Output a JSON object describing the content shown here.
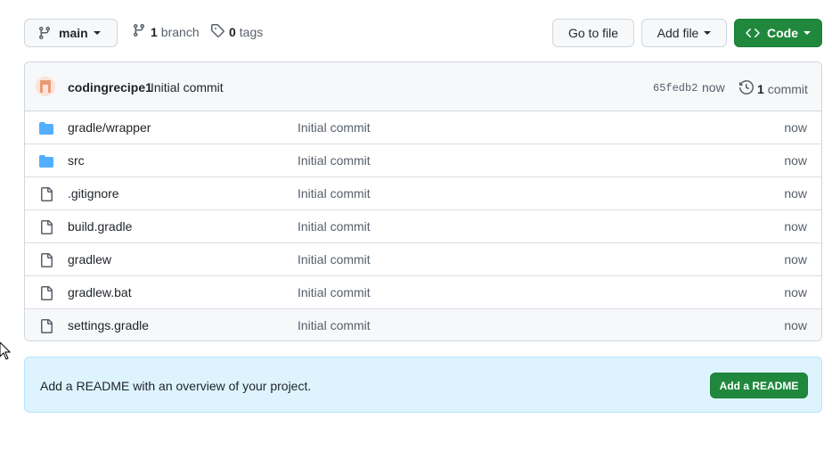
{
  "toolbar": {
    "branch_label": "main",
    "branches_count": "1",
    "branches_label": "branch",
    "tags_count": "0",
    "tags_label": "tags",
    "goto_label": "Go to file",
    "add_file_label": "Add file",
    "code_label": "Code"
  },
  "latest_commit": {
    "author": "codingrecipe1",
    "message": "Initial commit",
    "sha": "65fedb2",
    "time": "now",
    "commits_count": "1",
    "commits_label": "commit"
  },
  "files": [
    {
      "name": "gradle/wrapper",
      "type": "folder",
      "message": "Initial commit",
      "time": "now"
    },
    {
      "name": "src",
      "type": "folder",
      "message": "Initial commit",
      "time": "now"
    },
    {
      "name": ".gitignore",
      "type": "file",
      "message": "Initial commit",
      "time": "now"
    },
    {
      "name": "build.gradle",
      "type": "file",
      "message": "Initial commit",
      "time": "now"
    },
    {
      "name": "gradlew",
      "type": "file",
      "message": "Initial commit",
      "time": "now"
    },
    {
      "name": "gradlew.bat",
      "type": "file",
      "message": "Initial commit",
      "time": "now"
    },
    {
      "name": "settings.gradle",
      "type": "file",
      "message": "Initial commit",
      "time": "now"
    }
  ],
  "readme": {
    "text": "Add a README with an overview of your project.",
    "button_label": "Add a README"
  },
  "colors": {
    "primary_green": "#1f883d",
    "folder_blue": "#54aeff",
    "readme_bg": "#ddf4ff"
  }
}
